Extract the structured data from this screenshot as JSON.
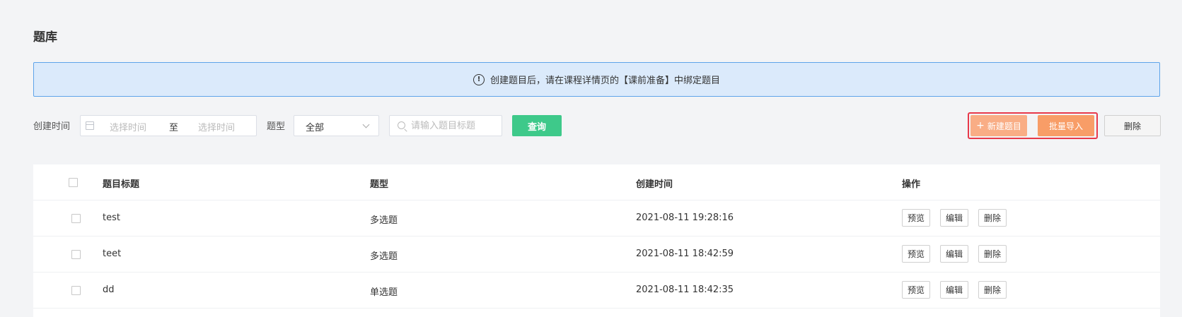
{
  "page": {
    "title": "题库"
  },
  "notice": {
    "text": "创建题目后，请在课程详情页的【课前准备】中绑定题目"
  },
  "filters": {
    "created_label": "创建时间",
    "start_placeholder": "选择时间",
    "range_separator": "至",
    "end_placeholder": "选择时间",
    "type_label": "题型",
    "type_value": "全部",
    "search_placeholder": "请输入题目标题",
    "query_button": "查询"
  },
  "actions": {
    "new_button": "新建题目",
    "import_button": "批量导入",
    "delete_button": "删除"
  },
  "table": {
    "columns": [
      "题目标题",
      "题型",
      "创建时间",
      "操作"
    ],
    "rows": [
      {
        "title": "test",
        "type": "多选题",
        "created": "2021-08-11 19:28:16"
      },
      {
        "title": "teet",
        "type": "多选题",
        "created": "2021-08-11 18:42:59"
      },
      {
        "title": "dd",
        "type": "单选题",
        "created": "2021-08-11 18:42:35"
      }
    ],
    "row_actions": {
      "preview": "预览",
      "edit": "编辑",
      "delete": "删除"
    }
  },
  "colors": {
    "accent_green": "#3ec98a",
    "accent_orange": "#f89d67",
    "highlight_red": "#e8394a",
    "notice_bg": "#dbeafb"
  }
}
